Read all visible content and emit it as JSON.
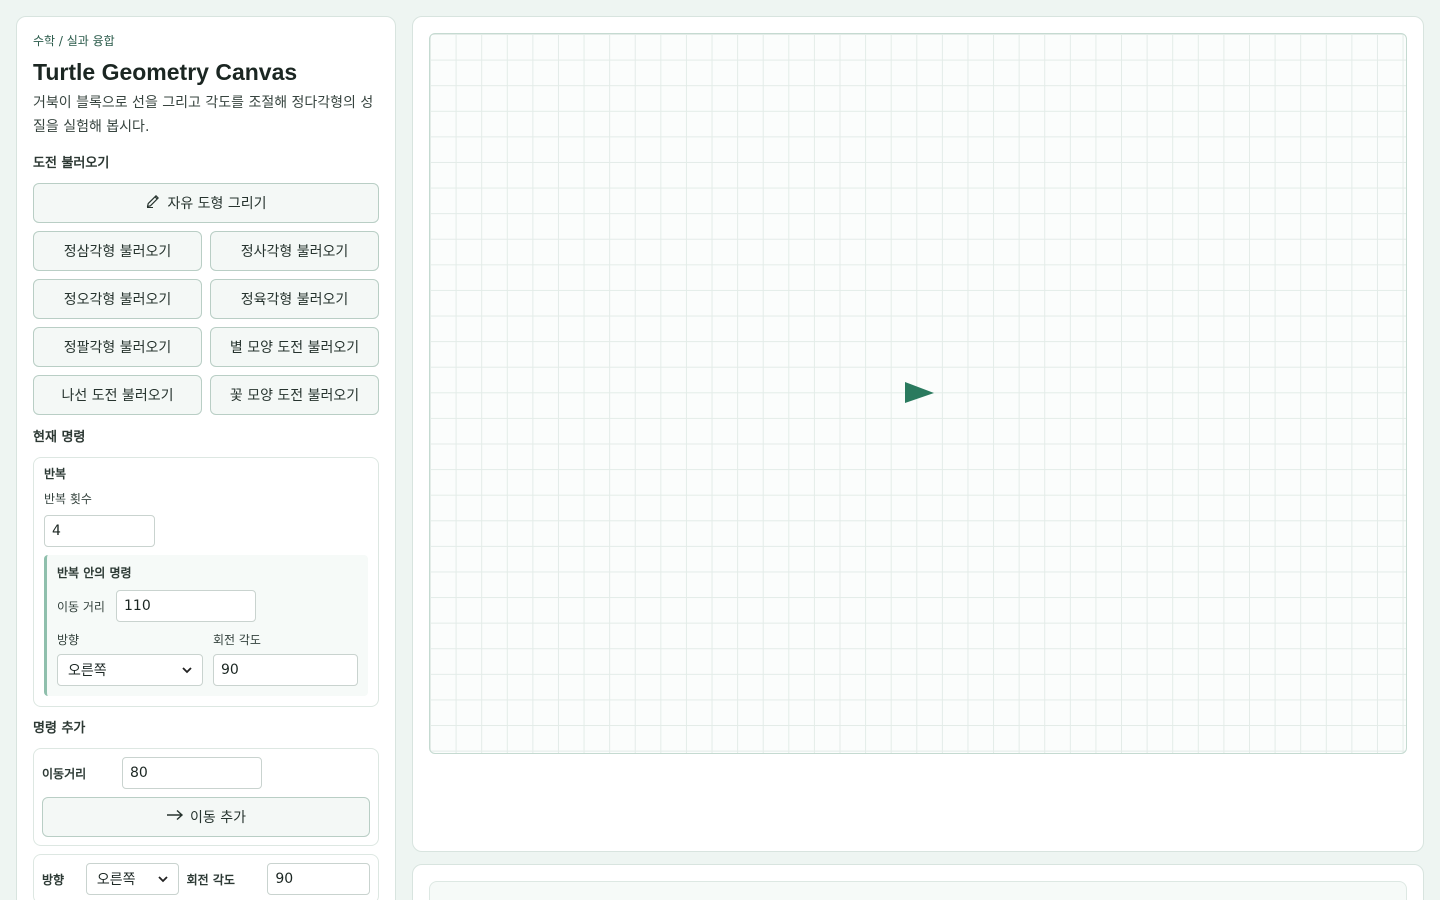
{
  "breadcrumb": "수학 / 실과 융합",
  "title": "Turtle Geometry Canvas",
  "description": "거북이 블록으로 선을 그리고 각도를 조절해 정다각형의 성질을 실험해 봅시다.",
  "challenges": {
    "heading": "도전 불러오기",
    "free_draw": "자유 도형 그리기",
    "items": [
      "정삼각형 불러오기",
      "정사각형 불러오기",
      "정오각형 불러오기",
      "정육각형 불러오기",
      "정팔각형 불러오기",
      "별 모양 도전 불러오기",
      "나선 도전 불러오기",
      "꽃 모양 도전 불러오기"
    ]
  },
  "current": {
    "heading": "현재 명령",
    "repeat_title": "반복",
    "repeat_count_label": "반복 횟수",
    "repeat_count": "4",
    "inner_title": "반복 안의 명령",
    "move_label": "이동 거리",
    "move_value": "110",
    "direction_label": "방향",
    "direction_value": "오른쪽",
    "angle_label": "회전 각도",
    "angle_value": "90"
  },
  "add": {
    "heading": "명령 추가",
    "move_label": "이동거리",
    "move_value": "80",
    "move_button": "이동 추가",
    "direction_label": "방향",
    "direction_value": "오른쪽",
    "angle_label": "회전 각도",
    "angle_value": "90"
  },
  "colors": {
    "turtle": "#2a7a5e",
    "accent": "#8fbfac",
    "grid": "#e3ece8"
  },
  "icons": {
    "free_draw": "pencil-icon",
    "move_add": "arrow-right-icon",
    "select": "chevron-down-icon",
    "turtle": "turtle-triangle-icon"
  }
}
